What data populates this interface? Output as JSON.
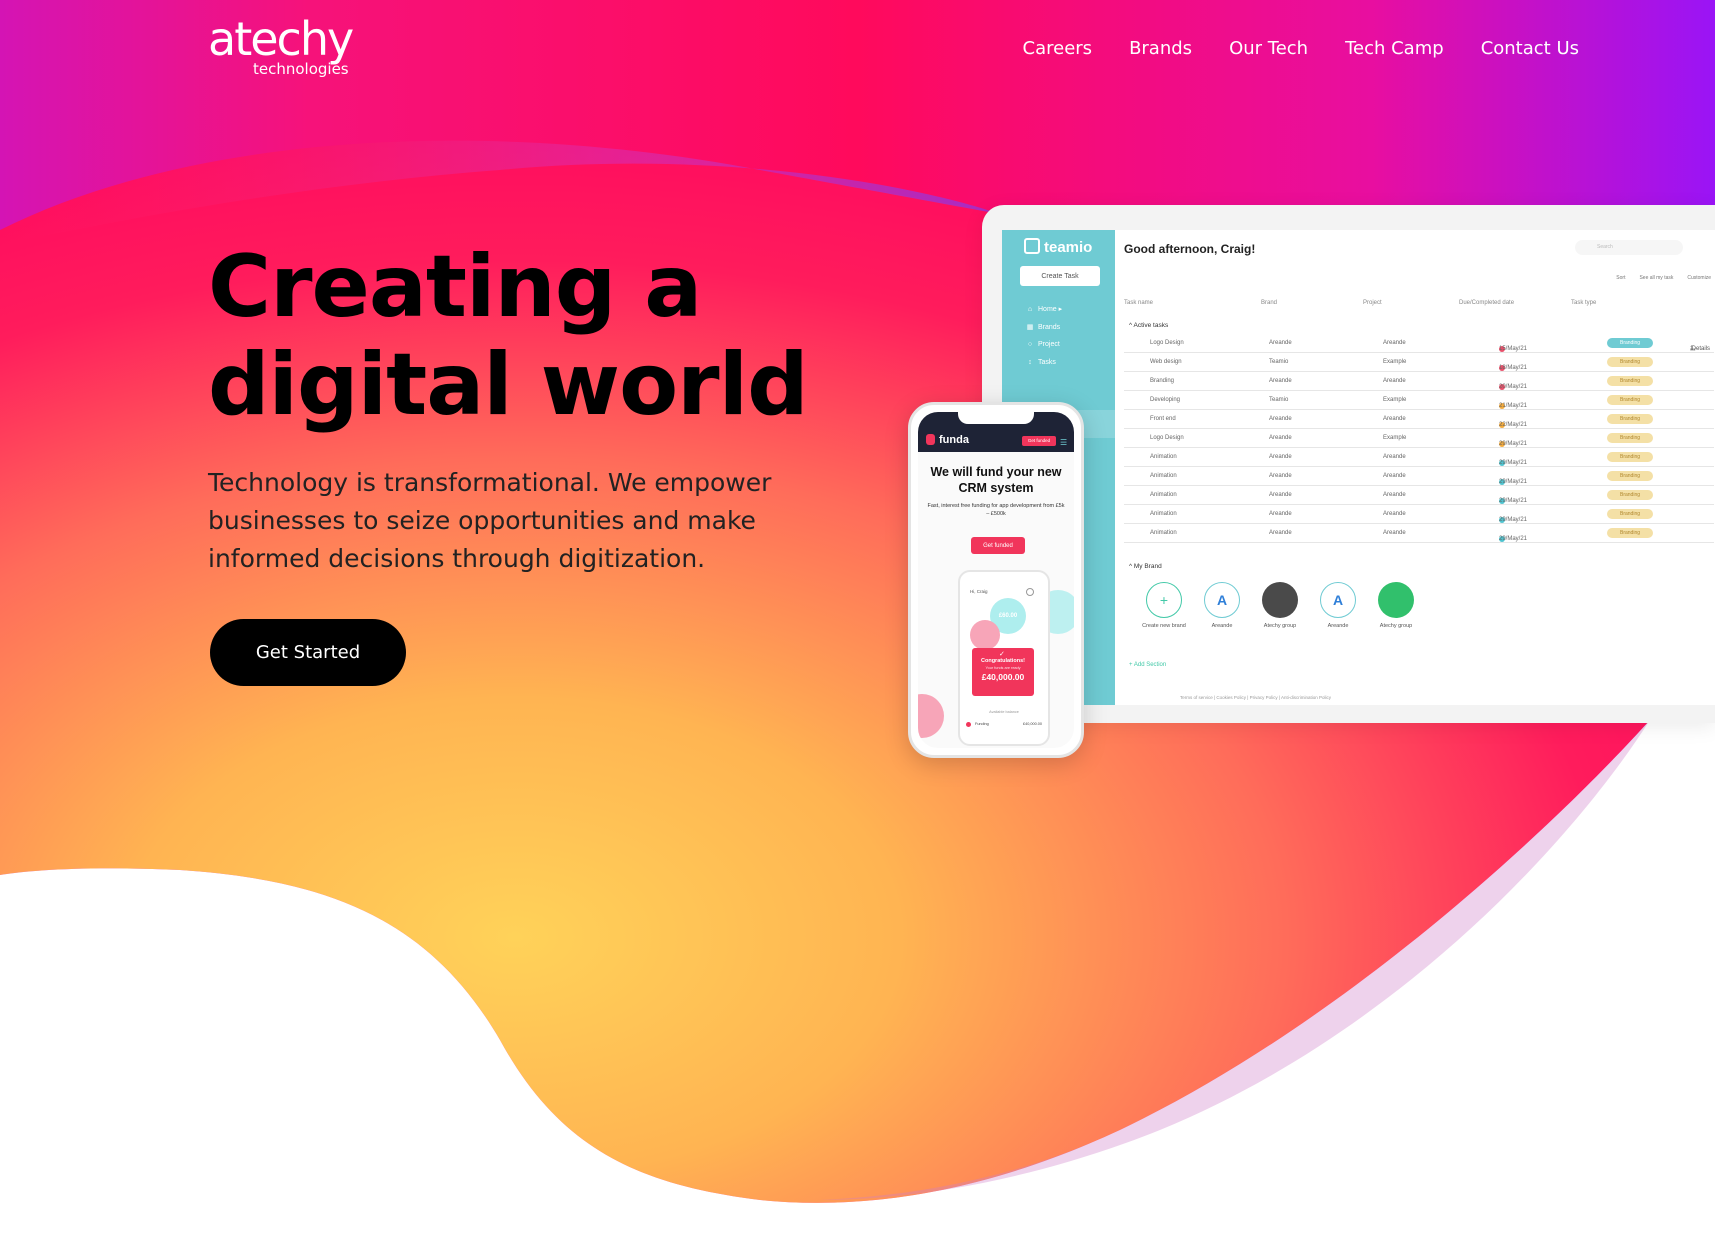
{
  "brand": {
    "logo_main": "atechy",
    "logo_sub": "technologies"
  },
  "nav": {
    "items": [
      "Careers",
      "Brands",
      "Our Tech",
      "Tech Camp",
      "Contact Us"
    ]
  },
  "hero": {
    "title": "Creating a digital world",
    "subtitle": "Technology is transformational. We empower businesses to seize opportunities and make informed decisions through digitization.",
    "cta": "Get Started"
  },
  "laptop": {
    "app_name": "teamio",
    "greeting": "Good afternoon, Craig!",
    "create_task": "Create Task",
    "search_placeholder": "Search",
    "sidebar": [
      "Home",
      "Brands",
      "Project",
      "Tasks"
    ],
    "tools": [
      "Sort",
      "See all my task",
      "Customize"
    ],
    "columns": [
      "Task name",
      "Brand",
      "Project",
      "Due/Completed date",
      "Task type"
    ],
    "active_label": "Active tasks",
    "rows": [
      {
        "task": "Logo Design",
        "brand": "Areande",
        "project": "Areande",
        "date": "15/May/21",
        "dot": "#e8506a",
        "type": "Branding",
        "active": true
      },
      {
        "task": "Web design",
        "brand": "Teamio",
        "project": "Example",
        "date": "18/May/21",
        "dot": "#e8506a",
        "type": "Branding"
      },
      {
        "task": "Branding",
        "brand": "Areande",
        "project": "Areande",
        "date": "20/May/21",
        "dot": "#e8506a",
        "type": "Branding"
      },
      {
        "task": "Developing",
        "brand": "Teamio",
        "project": "Example",
        "date": "21/May/21",
        "dot": "#f2a93b",
        "type": "Branding"
      },
      {
        "task": "Front end",
        "brand": "Areande",
        "project": "Areande",
        "date": "22/May/21",
        "dot": "#f2a93b",
        "type": "Branding"
      },
      {
        "task": "Logo Design",
        "brand": "Areande",
        "project": "Example",
        "date": "29/May/21",
        "dot": "#f2a93b",
        "type": "Branding"
      },
      {
        "task": "Animation",
        "brand": "Areande",
        "project": "Areande",
        "date": "29/May/21",
        "dot": "#4fc3cf",
        "type": "Branding"
      },
      {
        "task": "Animation",
        "brand": "Areande",
        "project": "Areande",
        "date": "29/May/21",
        "dot": "#4fc3cf",
        "type": "Branding"
      },
      {
        "task": "Animation",
        "brand": "Areande",
        "project": "Areande",
        "date": "29/May/21",
        "dot": "#4fc3cf",
        "type": "Branding"
      },
      {
        "task": "Animation",
        "brand": "Areande",
        "project": "Areande",
        "date": "29/May/21",
        "dot": "#4fc3cf",
        "type": "Branding"
      },
      {
        "task": "Animation",
        "brand": "Areande",
        "project": "Areande",
        "date": "29/May/21",
        "dot": "#4fc3cf",
        "type": "Branding"
      }
    ],
    "details_label": "Details",
    "details_count": "1",
    "my_brand_label": "My Brand",
    "brands": [
      {
        "label": "Create new brand",
        "kind": "plus"
      },
      {
        "label": "Areande",
        "kind": "logo"
      },
      {
        "label": "Atechy group",
        "kind": "dark"
      },
      {
        "label": "Areande",
        "kind": "logo"
      },
      {
        "label": "Atechy group",
        "kind": "green"
      }
    ],
    "add_section": "Add Section",
    "footer": "Terms of service  |  Cookies Policy  |  Privacy Policy  |  Anti-discrimination Policy"
  },
  "phone": {
    "app_name": "funda",
    "header_button": "Get funded",
    "title": "We will fund your new CRM system",
    "subtitle": "Fast, interest free funding for app development from £5k – £500k",
    "cta": "Get funded",
    "mini_greeting": "Hi, Craig",
    "congrats": "Congratulations!",
    "congrats_caption": "Your funds are ready",
    "amount": "£40,000.00",
    "mini_value": "£60.00",
    "mini_caption": "Available balance",
    "mini_row_label": "Funding",
    "mini_row_amount": "£40,000.00"
  },
  "colors": {
    "accent_teal": "#6fcbd3",
    "accent_pink": "#f1355b",
    "branding_tag": "#f4e0a6"
  }
}
